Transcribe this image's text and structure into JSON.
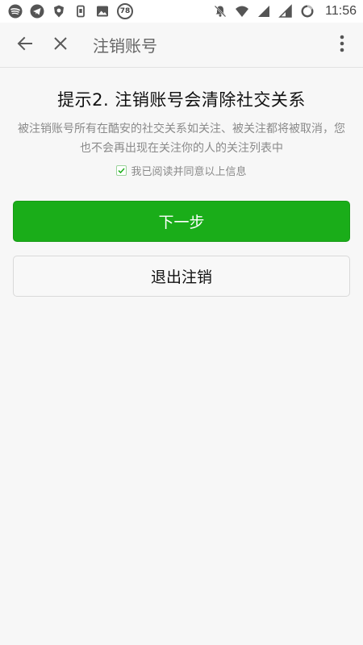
{
  "status_bar": {
    "time": "11:56",
    "notification_count": "78",
    "icons_left": [
      "spotify-icon",
      "telegram-icon",
      "shield-app-icon",
      "sim-icon",
      "image-icon",
      "badge-78-icon"
    ],
    "icons_right": [
      "mute-icon",
      "wifi-icon",
      "signal-icon",
      "signal-icon",
      "battery-ring-icon"
    ]
  },
  "toolbar": {
    "title": "注销账号"
  },
  "main": {
    "heading": "提示2. 注销账号会清除社交关系",
    "description": "被注销账号所有在酷安的社交关系如关注、被关注都将被取消，您也不会再出现在关注你的人的关注列表中",
    "agree_label": "我已阅读并同意以上信息",
    "agree_checked": true,
    "next_button": "下一步",
    "cancel_button": "退出注销"
  },
  "colors": {
    "primary": "#1aad19",
    "background": "#f7f7f7"
  }
}
